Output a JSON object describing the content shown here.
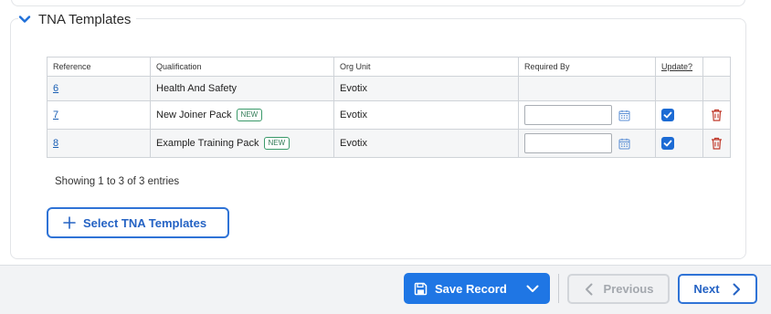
{
  "section": {
    "title": "TNA Templates"
  },
  "table": {
    "columns": [
      "Reference",
      "Qualification",
      "Org Unit",
      "Required By",
      "Update?",
      ""
    ],
    "rows": [
      {
        "reference": "6",
        "qualification": "Health And Safety",
        "badge": "",
        "org_unit": "Evotix",
        "required_by": "",
        "update": false,
        "editable": false
      },
      {
        "reference": "7",
        "qualification": "New Joiner Pack",
        "badge": "NEW",
        "org_unit": "Evotix",
        "required_by": "",
        "update": true,
        "editable": true
      },
      {
        "reference": "8",
        "qualification": "Example Training Pack",
        "badge": "NEW",
        "org_unit": "Evotix",
        "required_by": "",
        "update": true,
        "editable": true
      }
    ]
  },
  "entries_info": "Showing 1 to 3 of 3 entries",
  "select_button": {
    "label": "Select TNA Templates",
    "icon": "plus-icon"
  },
  "footer": {
    "save_label": "Save Record",
    "previous_label": "Previous",
    "next_label": "Next"
  },
  "colors": {
    "accent": "#1f76e4",
    "link": "#1a5fb4",
    "danger": "#c0392b",
    "badge": "#3a9a6a"
  }
}
